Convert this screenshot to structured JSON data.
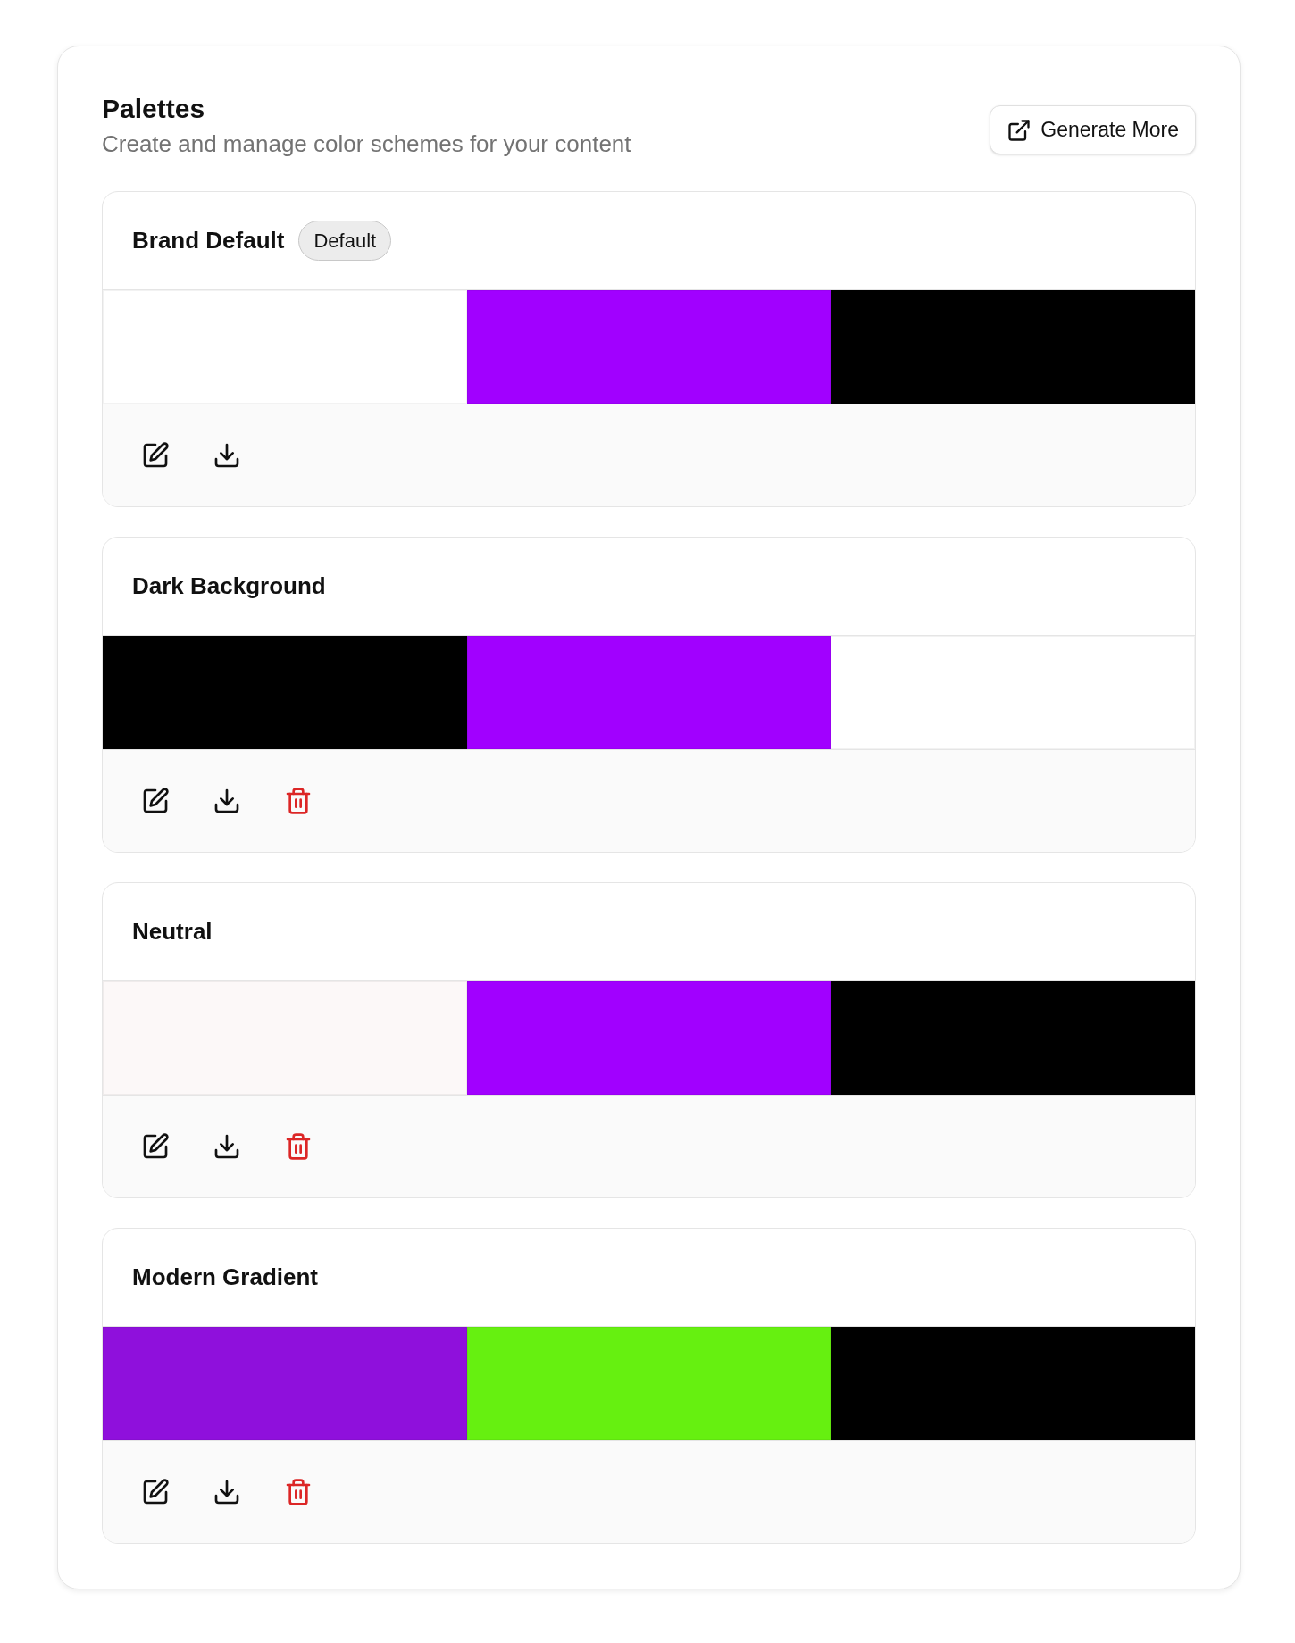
{
  "header": {
    "title": "Palettes",
    "subtitle": "Create and manage color schemes for your content",
    "action": "Generate More"
  },
  "palettes": [
    {
      "name": "Brand Default",
      "badge": "Default",
      "deletable": false,
      "swatches": [
        {
          "color": "#ffffff"
        },
        {
          "color": "#a100ff"
        },
        {
          "color": "#000000"
        }
      ]
    },
    {
      "name": "Dark Background",
      "deletable": true,
      "swatches": [
        {
          "color": "#000000"
        },
        {
          "color": "#a100ff"
        },
        {
          "color": "#ffffff"
        }
      ]
    },
    {
      "name": "Neutral",
      "deletable": true,
      "swatches": [
        {
          "color": "#fcf8f8"
        },
        {
          "color": "#a100ff"
        },
        {
          "color": "#000000"
        }
      ]
    },
    {
      "name": "Modern Gradient",
      "deletable": true,
      "swatches": [
        {
          "color": "#8f10dc"
        },
        {
          "color": "#66f010"
        },
        {
          "color": "#000000"
        }
      ]
    }
  ]
}
